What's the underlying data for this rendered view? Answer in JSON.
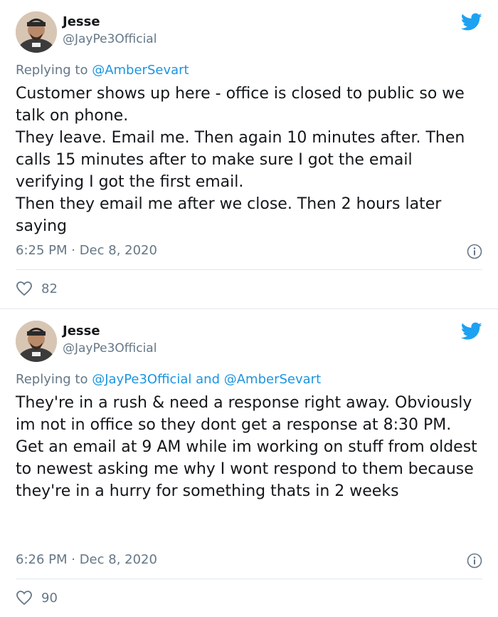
{
  "tweets": [
    {
      "name": "Jesse",
      "handle": "@JayPe3Official",
      "replying_prefix": "Replying to ",
      "replying_to": "@AmberSevart",
      "body_lines": [
        "Customer shows up here - office is closed to public so we talk on phone.",
        "They leave. Email me. Then again 10 minutes after. Then calls 15 minutes after to make sure I got the email verifying I got the first email.",
        "Then they email me after we close. Then 2 hours later saying"
      ],
      "timestamp": "6:25 PM · Dec 8, 2020",
      "likes": "82"
    },
    {
      "name": "Jesse",
      "handle": "@JayPe3Official",
      "replying_prefix": "Replying to ",
      "replying_to": "@JayPe3Official and @AmberSevart",
      "body_lines": [
        "They're in a rush & need a response right away. Obviously im not in office so they dont get a response at 8:30 PM.",
        "Get an email at 9 AM while im working on stuff from oldest to newest asking me why I wont respond to them because they're in a hurry for something thats in 2 weeks"
      ],
      "timestamp": "6:26 PM · Dec 8, 2020",
      "likes": "90"
    }
  ],
  "colors": {
    "twitter_blue": "#1da1f2",
    "link_blue": "#1b95e0",
    "muted": "#657786",
    "border": "#e1e8ed"
  },
  "icons": [
    "twitter-bird-icon",
    "info-icon",
    "heart-icon"
  ]
}
